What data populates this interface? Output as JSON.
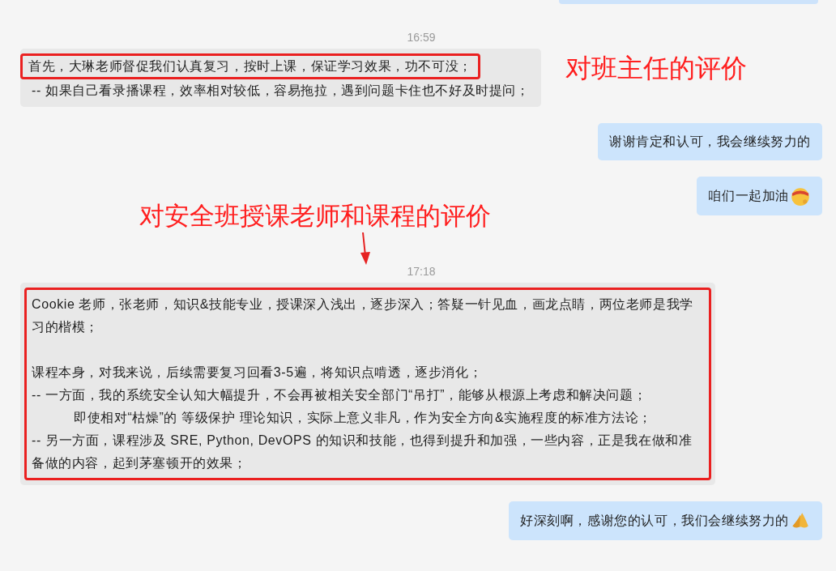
{
  "items": [
    {
      "kind": "cut_bubble"
    },
    {
      "kind": "time",
      "text": "16:59"
    },
    {
      "kind": "received",
      "boxed": false,
      "note": "对班主任的评价",
      "lines": [
        {
          "text": "首先，大琳老师督促我们认真复习，按时上课，保证学习效果，功不可没；",
          "boxed": true,
          "indent": false,
          "gap_before": false
        },
        {
          "text": "-- 如果自己看录播课程，效率相对较低，容易拖拉，遇到问题卡住也不好及时提问；",
          "boxed": false,
          "indent": false,
          "gap_before": false
        }
      ]
    },
    {
      "kind": "sent",
      "text": "谢谢肯定和认可，我会继续努力的"
    },
    {
      "kind": "sent",
      "text": "咱们一起加油",
      "emoji": {
        "kind": "face"
      }
    },
    {
      "kind": "annotation",
      "text": "对安全班授课老师和课程的评价",
      "arrow": true
    },
    {
      "kind": "time",
      "text": "17:18"
    },
    {
      "kind": "received",
      "boxed": true,
      "lines": [
        {
          "text": "Cookie 老师，张老师，知识&技能专业，授课深入浅出，逐步深入；答疑一针见血，画龙点睛，两位老师是我学习的楷模；",
          "boxed": false,
          "indent": false,
          "gap_before": false
        },
        {
          "text": "课程本身，对我来说，后续需要复习回看3-5遍，将知识点啃透，逐步消化；",
          "boxed": false,
          "indent": false,
          "gap_before": true
        },
        {
          "text": "-- 一方面，我的系统安全认知大幅提升，不会再被相关安全部门“吊打”，能够从根源上考虑和解决问题；",
          "boxed": false,
          "indent": false,
          "gap_before": false
        },
        {
          "text": "即使相对“枯燥”的 等级保护 理论知识，实际上意义非凡，作为安全方向&实施程度的标准方法论；",
          "boxed": false,
          "indent": true,
          "gap_before": false
        },
        {
          "text": "-- 另一方面，课程涉及 SRE, Python, DevOPS 的知识和技能，也得到提升和加强，一些内容，正是我在做和准备做的内容，起到茅塞顿开的效果；",
          "boxed": false,
          "indent": false,
          "gap_before": false
        }
      ]
    },
    {
      "kind": "sent",
      "text": "好深刻啊，感谢您的认可，我们会继续努力的",
      "emoji": {
        "kind": "hands"
      }
    }
  ]
}
